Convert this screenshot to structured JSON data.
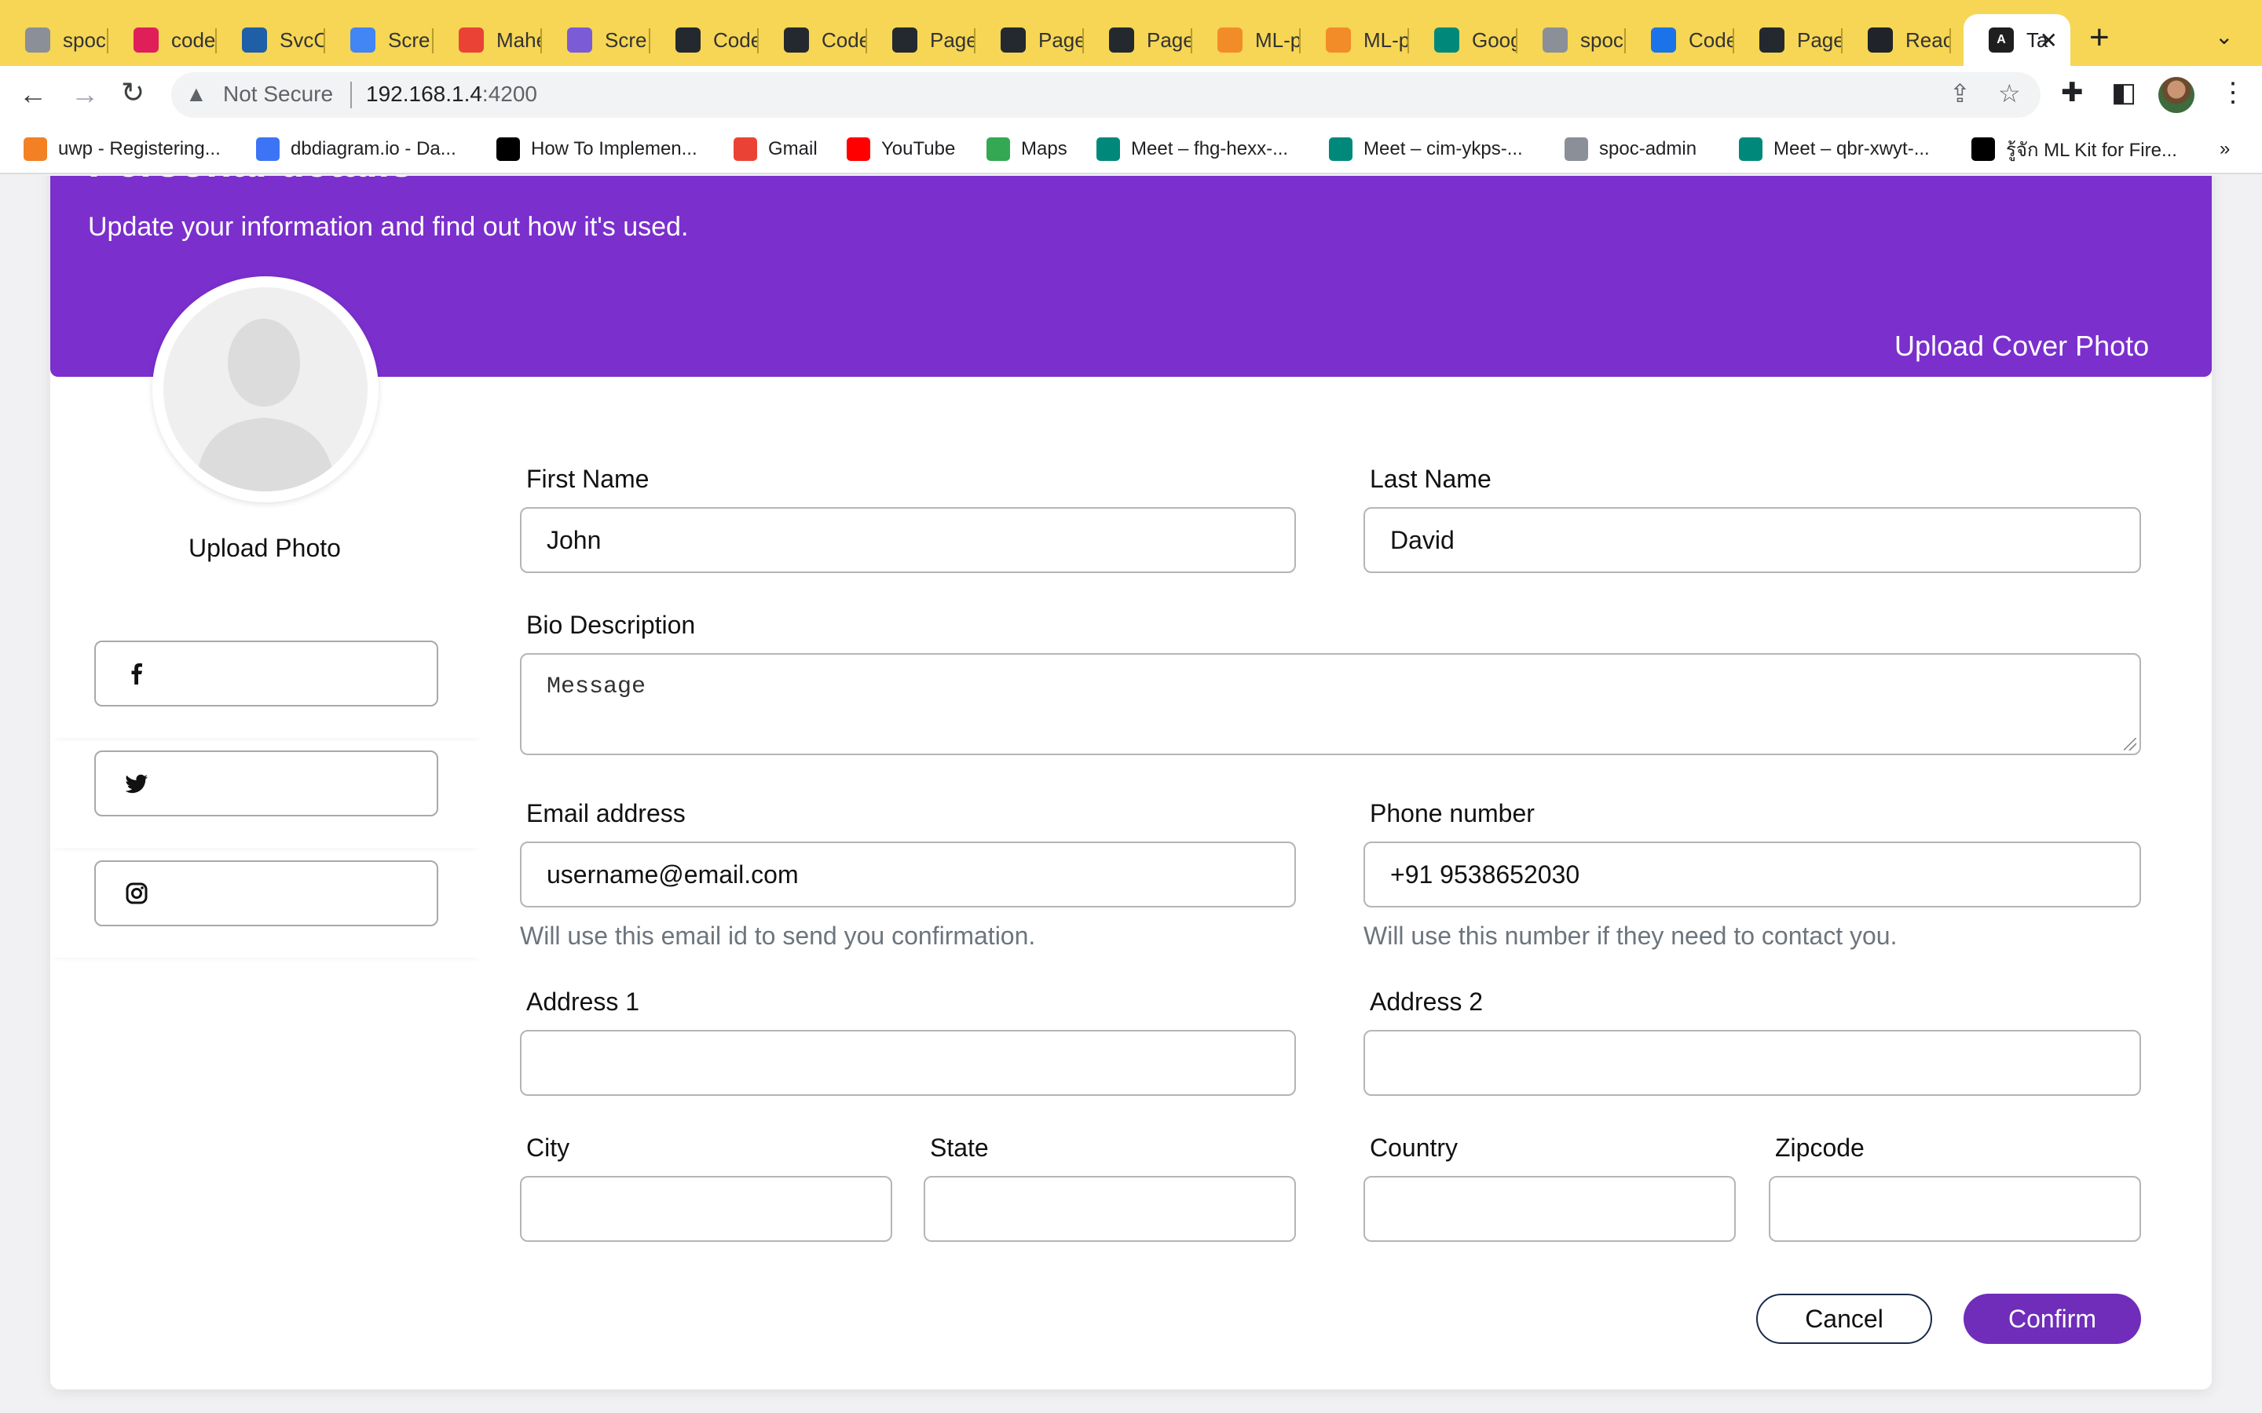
{
  "browser": {
    "tabs": [
      {
        "title": "spoc",
        "icon": "spoc-favicon",
        "color": "#8a8f98"
      },
      {
        "title": "code",
        "icon": "slack-favicon",
        "color": "#e01e5a"
      },
      {
        "title": "SvcC",
        "icon": "svc-favicon",
        "color": "#1f5fa8"
      },
      {
        "title": "Scre",
        "icon": "docs-favicon",
        "color": "#4285f4"
      },
      {
        "title": "Mahe",
        "icon": "gmail-favicon",
        "color": "#ea4335"
      },
      {
        "title": "Scre",
        "icon": "screen-favicon",
        "color": "#7b5cd6"
      },
      {
        "title": "Code",
        "icon": "github-favicon",
        "color": "#24292f"
      },
      {
        "title": "Code",
        "icon": "github-favicon",
        "color": "#24292f"
      },
      {
        "title": "Page",
        "icon": "github-favicon",
        "color": "#24292f"
      },
      {
        "title": "Page",
        "icon": "github-favicon",
        "color": "#24292f"
      },
      {
        "title": "Page",
        "icon": "github-favicon",
        "color": "#24292f"
      },
      {
        "title": "ML-p",
        "icon": "box-favicon",
        "color": "#f28c28"
      },
      {
        "title": "ML-p",
        "icon": "box-favicon",
        "color": "#f28c28"
      },
      {
        "title": "Goog",
        "icon": "meet-favicon",
        "color": "#00897b"
      },
      {
        "title": "spoc",
        "icon": "spoc-favicon",
        "color": "#8a8f98"
      },
      {
        "title": "Code",
        "icon": "calendar-favicon",
        "color": "#1a73e8"
      },
      {
        "title": "Page",
        "icon": "github-favicon",
        "color": "#24292f"
      },
      {
        "title": "Reac",
        "icon": "react-favicon",
        "color": "#20232a"
      }
    ],
    "active_tab": {
      "title": "Ta",
      "icon": "angular-favicon",
      "color": "#1f1f1f"
    },
    "new_tab": "+",
    "url_warning": "Not Secure",
    "url_host": "192.168.1.4",
    "url_port": ":4200",
    "bookmarks": [
      {
        "label": "uwp - Registering...",
        "icon": "stackoverflow-favicon",
        "color": "#f48024"
      },
      {
        "label": "dbdiagram.io - Da...",
        "icon": "dbdiagram-favicon",
        "color": "#3d74f6"
      },
      {
        "label": "How To Implemen...",
        "icon": "medium-favicon",
        "color": "#000000"
      },
      {
        "label": "Gmail",
        "icon": "gmail-favicon",
        "color": "#ea4335"
      },
      {
        "label": "YouTube",
        "icon": "youtube-favicon",
        "color": "#ff0000"
      },
      {
        "label": "Maps",
        "icon": "maps-favicon",
        "color": "#34a853"
      },
      {
        "label": "Meet – fhg-hexx-...",
        "icon": "meet-favicon",
        "color": "#00897b"
      },
      {
        "label": "Meet – cim-ykps-...",
        "icon": "meet-favicon",
        "color": "#00897b"
      },
      {
        "label": "spoc-admin",
        "icon": "spoc-favicon",
        "color": "#8a8f98"
      },
      {
        "label": "Meet – qbr-xwyt-...",
        "icon": "meet-favicon",
        "color": "#00897b"
      },
      {
        "label": "รู้จัก ML Kit for Fire...",
        "icon": "medium-favicon",
        "color": "#000000"
      }
    ],
    "bookmarks_overflow": "»"
  },
  "page": {
    "title": "Personal details",
    "subtitle": "Update your information and find out how it's used.",
    "upload_cover": "Upload Cover Photo",
    "upload_photo": "Upload Photo",
    "socials": [
      {
        "network": "facebook",
        "value": ""
      },
      {
        "network": "twitter",
        "value": ""
      },
      {
        "network": "instagram",
        "value": ""
      }
    ],
    "form": {
      "first_name_label": "First Name",
      "first_name_value": "John",
      "last_name_label": "Last Name",
      "last_name_value": "David",
      "bio_label": "Bio Description",
      "bio_placeholder": "Message",
      "email_label": "Email address",
      "email_value": "username@email.com",
      "email_help": "Will use this email id to send you confirmation.",
      "phone_label": "Phone number",
      "phone_value": "+91 9538652030",
      "phone_help": "Will use this number if they need to contact you.",
      "address1_label": "Address 1",
      "address2_label": "Address 2",
      "city_label": "City",
      "state_label": "State",
      "country_label": "Country",
      "zipcode_label": "Zipcode"
    },
    "cancel_label": "Cancel",
    "confirm_label": "Confirm"
  },
  "colors": {
    "tabstrip": "#f6d654",
    "cover": "#7b2fcd",
    "confirm": "#6f2db9"
  }
}
